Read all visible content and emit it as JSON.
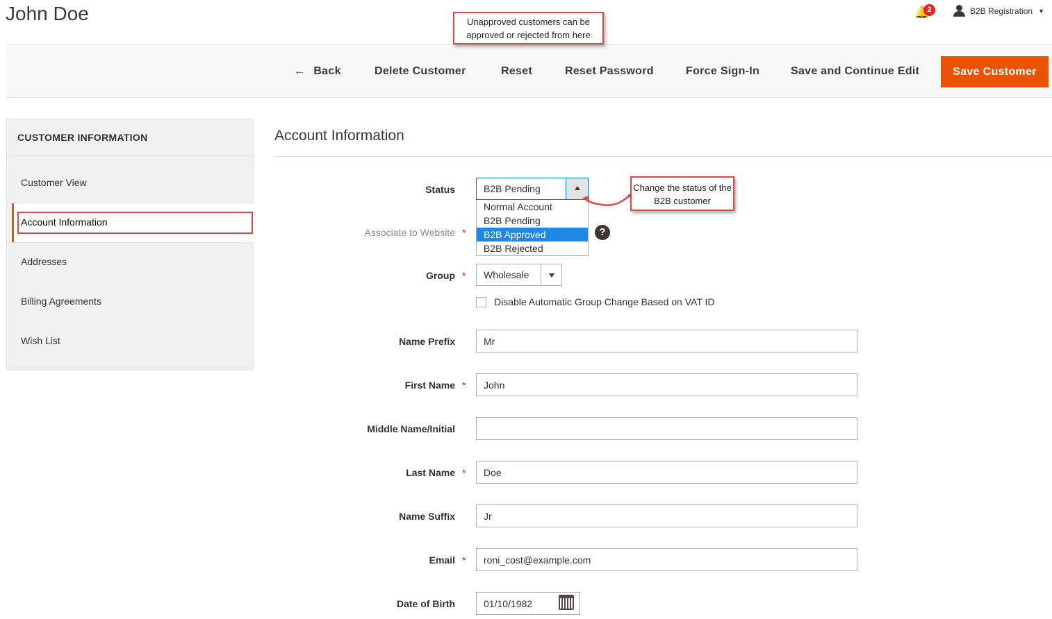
{
  "header": {
    "page_title": "John Doe",
    "notification_count": "2",
    "user_menu_label": "B2B Registration"
  },
  "annotations": {
    "top_note": "Unapproved customers can be approved or rejected from here",
    "status_note": "Change the status of the B2B customer"
  },
  "actions": {
    "back": "Back",
    "delete": "Delete Customer",
    "reset": "Reset",
    "reset_password": "Reset Password",
    "force_signin": "Force Sign-In",
    "save_continue": "Save and Continue Edit",
    "save": "Save Customer"
  },
  "sidebar": {
    "title": "CUSTOMER INFORMATION",
    "items": [
      {
        "label": "Customer View"
      },
      {
        "label": "Account Information",
        "active": true
      },
      {
        "label": "Addresses"
      },
      {
        "label": "Billing Agreements"
      },
      {
        "label": "Wish List"
      }
    ]
  },
  "form": {
    "section_title": "Account Information",
    "status": {
      "label": "Status",
      "value": "B2B Pending",
      "options": [
        "Normal Account",
        "B2B Pending",
        "B2B Approved",
        "B2B Rejected"
      ],
      "highlighted_option": "B2B Approved"
    },
    "website": {
      "label": "Associate to Website",
      "required": "*"
    },
    "group": {
      "label": "Group",
      "value": "Wholesale",
      "required": "*"
    },
    "disable_group_change": {
      "label": "Disable Automatic Group Change Based on VAT ID",
      "checked": false
    },
    "name_prefix": {
      "label": "Name Prefix",
      "value": "Mr"
    },
    "first_name": {
      "label": "First Name",
      "value": "John",
      "required": "*"
    },
    "middle_name": {
      "label": "Middle Name/Initial",
      "value": ""
    },
    "last_name": {
      "label": "Last Name",
      "value": "Doe",
      "required": "*"
    },
    "name_suffix": {
      "label": "Name Suffix",
      "value": "Jr"
    },
    "email": {
      "label": "Email",
      "value": "roni_cost@example.com",
      "required": "*"
    },
    "dob": {
      "label": "Date of Birth",
      "value": "01/10/1982"
    }
  },
  "colors": {
    "accent": "#eb5202",
    "annotation_border": "#e04848",
    "selected_option": "#1e88e5"
  }
}
